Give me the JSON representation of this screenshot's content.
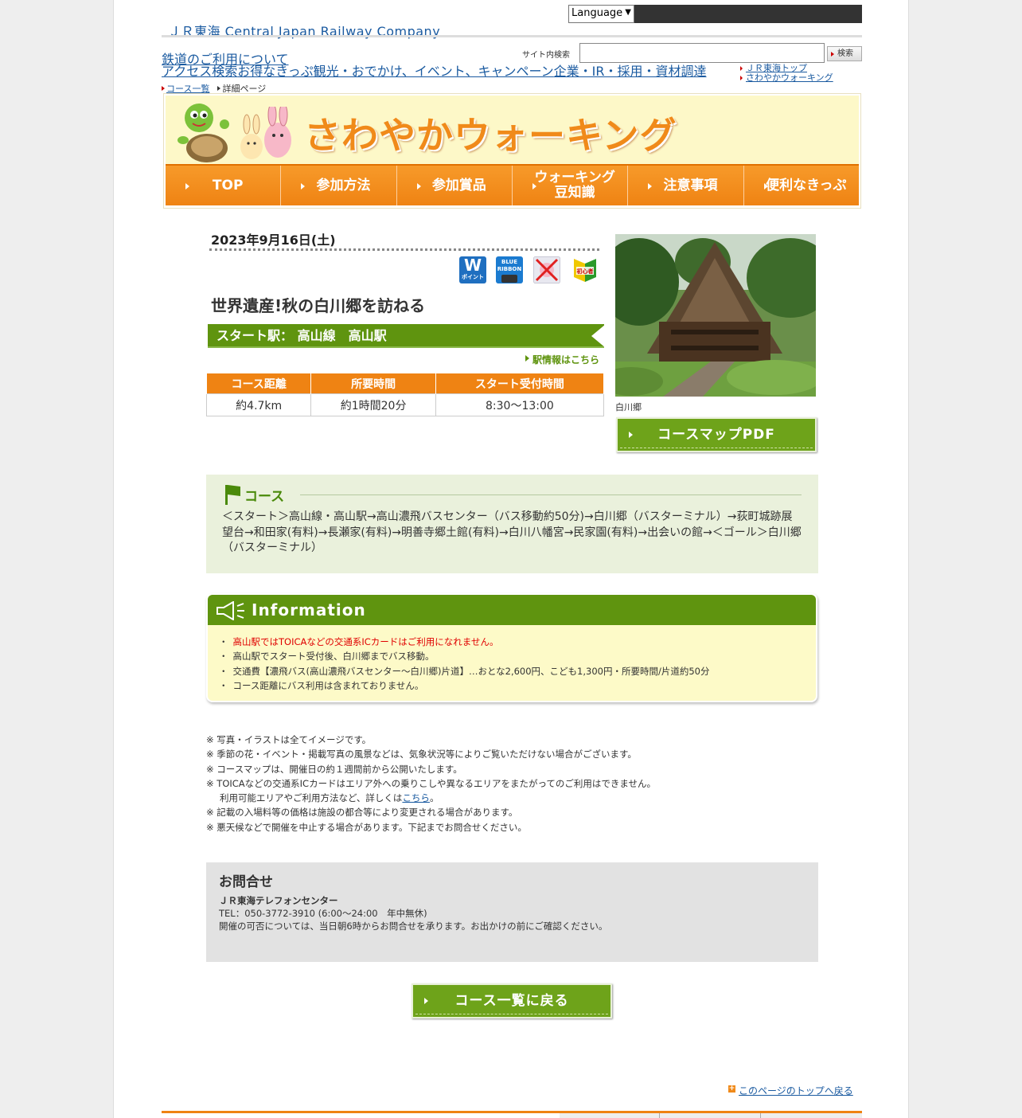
{
  "header": {
    "language_label": "Language",
    "company": "ＪＲ東海 Central Japan Railway Company",
    "search_label": "サイト内検索",
    "search_button": "検索",
    "nav": [
      "鉄道のご利用について",
      "アクセス検索",
      "お得なきっぷ",
      "観光・おでかけ、イベント、キャンペーン",
      "企業・IR・採用・資材調達"
    ],
    "nav_right": [
      "ＪＲ東海トップ",
      "さわやかウォーキング"
    ],
    "breadcrumb": [
      "コース一覧",
      "詳細ページ"
    ]
  },
  "banner": {
    "title": "さわやかウォーキング",
    "menu": [
      "TOP",
      "参加方法",
      "参加賞品",
      "ウォーキング豆知識",
      "注意事項",
      "便利なきっぷ"
    ],
    "menu_line1": "ウォーキング",
    "menu_line2": "豆知識"
  },
  "event": {
    "date": "2023年9月16日(土)",
    "badges": [
      "W ポイント",
      "BLUE RIBBON",
      "no-toica",
      "初心者"
    ],
    "badge_w": "W",
    "badge_w_sub": "ポイント",
    "badge_blue": "BLUE RIBBON",
    "badge_beginner": "初心者",
    "title": "世界遺産!秋の白川郷を訪ねる",
    "station": "スタート駅： 高山線　高山駅",
    "station_link": "駅情報はこちら",
    "table_headers": [
      "コース距離",
      "所要時間",
      "スタート受付時間"
    ],
    "table_values": [
      "約4.7km",
      "約1時間20分",
      "8:30～13:00"
    ],
    "photo_caption": "白川郷",
    "pdf_button": "コースマップPDF"
  },
  "course": {
    "heading": "コース",
    "text": "＜スタート＞高山線・高山駅→高山濃飛バスセンター（バス移動約50分)→白川郷（バスターミナル）→荻町城跡展望台→和田家(有料)→長瀬家(有料)→明善寺郷土館(有料)→白川八幡宮→民家園(有料)→出会いの館→＜ゴール＞白川郷（バスターミナル）"
  },
  "information": {
    "heading": "Information",
    "items": [
      "高山駅ではTOICAなどの交通系ICカードはご利用になれません。",
      "高山駅でスタート受付後、白川郷までバス移動。",
      "交通費【濃飛バス(高山濃飛バスセンター～白川郷)片道】…おとな2,600円、こども1,300円・所要時間/片道約50分",
      "コース距離にバス利用は含まれておりません。"
    ]
  },
  "notes": {
    "n1": "※ 写真・イラストは全てイメージです。",
    "n2": "※ 季節の花・イベント・掲載写真の風景などは、気象状況等によりご覧いただけない場合がございます。",
    "n3": "※ コースマップは、開催日の約１週間前から公開いたします。",
    "n4": "※ TOICAなどの交通系ICカードはエリア外への乗りこしや異なるエリアをまたがってのご利用はできません。",
    "n4b": "利用可能エリアやご利用方法など、詳しくは",
    "n4_link": "こちら",
    "n4_end": "。",
    "n5": "※ 記載の入場料等の価格は施設の都合等により変更される場合があります。",
    "n6": "※ 悪天候などで開催を中止する場合があります。下記までお問合せください。"
  },
  "contact": {
    "heading": "お問合せ",
    "org": "ＪＲ東海テレフォンセンター",
    "tel": "TEL：050-3772-3910 (6:00～24:00　年中無休)",
    "note": "開催の可否については、当日朝6時からお問合せを承ります。お出かけの前にご確認ください。"
  },
  "back_button": "コース一覧に戻る",
  "page_top": "このページのトップへ戻る",
  "colors": {
    "orange": "#ef8313",
    "green": "#5f940f",
    "link": "#1a5aa0"
  }
}
